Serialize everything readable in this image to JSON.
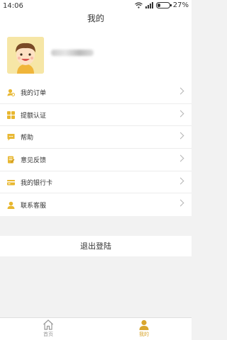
{
  "status_bar": {
    "time": "14:06",
    "battery_percent": "27%",
    "battery_level": 0.27
  },
  "header": {
    "title": "我的"
  },
  "profile": {
    "name_blurred": true
  },
  "menu": {
    "items": [
      {
        "label": "我的订单",
        "icon": "order-icon"
      },
      {
        "label": "提额认证",
        "icon": "certification-icon"
      },
      {
        "label": "帮助",
        "icon": "help-icon"
      },
      {
        "label": "意见反馈",
        "icon": "feedback-icon"
      },
      {
        "label": "我的银行卡",
        "icon": "bank-card-icon"
      },
      {
        "label": "联系客服",
        "icon": "customer-service-icon"
      }
    ]
  },
  "logout": {
    "label": "退出登陆"
  },
  "tabbar": {
    "tabs": [
      {
        "label": "首页",
        "icon": "home-icon",
        "active": false
      },
      {
        "label": "我的",
        "icon": "user-icon",
        "active": true
      }
    ]
  },
  "colors": {
    "accent": "#e8b730",
    "active_tab": "#d9a62e",
    "background": "#f2f2f2"
  }
}
